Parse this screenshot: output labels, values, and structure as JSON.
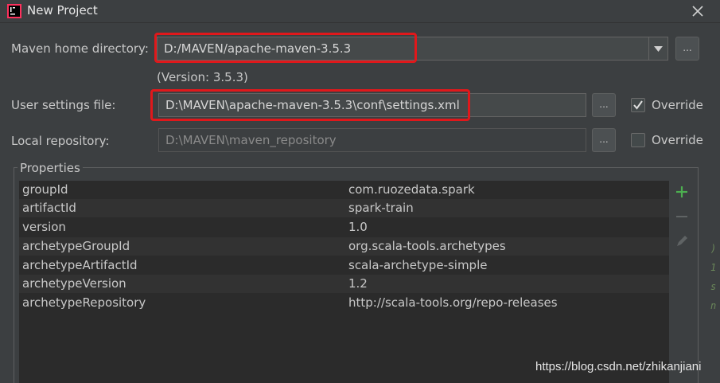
{
  "window": {
    "title": "New Project",
    "icon": "intellij-idea-icon",
    "close_icon": "close-icon"
  },
  "maven_home": {
    "label": "Maven home directory:",
    "value": "D:/MAVEN/apache-maven-3.5.3",
    "version": "(Version: 3.5.3)",
    "browse_label": "..."
  },
  "user_settings": {
    "label": "User settings file:",
    "value": "D:\\MAVEN\\apache-maven-3.5.3\\conf\\settings.xml",
    "browse_label": "...",
    "override_label": "Override",
    "override_checked": true
  },
  "local_repo": {
    "label": "Local repository:",
    "value": "D:\\MAVEN\\maven_repository",
    "browse_label": "...",
    "override_label": "Override",
    "override_checked": false
  },
  "properties": {
    "title": "Properties",
    "rows": [
      {
        "key": "groupId",
        "value": "com.ruozedata.spark"
      },
      {
        "key": "artifactId",
        "value": "spark-train"
      },
      {
        "key": "version",
        "value": "1.0"
      },
      {
        "key": "archetypeGroupId",
        "value": "org.scala-tools.archetypes"
      },
      {
        "key": "archetypeArtifactId",
        "value": "scala-archetype-simple"
      },
      {
        "key": "archetypeVersion",
        "value": "1.2"
      },
      {
        "key": "archetypeRepository",
        "value": "http://scala-tools.org/repo-releases"
      }
    ],
    "add_icon": "plus-icon",
    "remove_icon": "minus-icon",
    "edit_icon": "pencil-icon"
  },
  "editor_fragment": [
    ")",
    "1",
    "s",
    "n"
  ],
  "watermark": "https://blog.csdn.net/zhikanjiani",
  "colors": {
    "highlight": "#e0181b",
    "add": "#4caf50"
  }
}
